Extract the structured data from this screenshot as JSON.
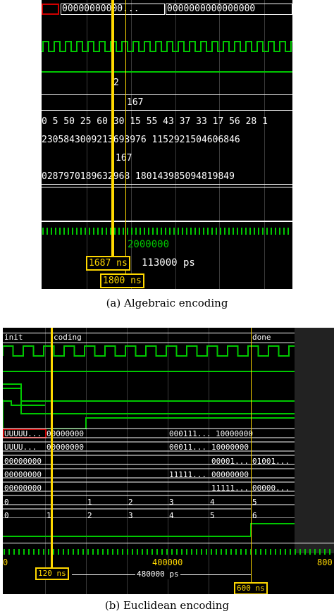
{
  "panel_a": {
    "caption": "(a) Algebraic encoding",
    "top_bus": "00000000000...",
    "top_bus_right": "0000000000000000",
    "val_2": "2",
    "val_167_a": "167",
    "row_numbers": "0 5 50 25 60 30 15 55 43 37 33 17 56 28 1",
    "row_big1": "2305843009213693976 1152921504606846",
    "val_167_b": "167",
    "row_big2": "0287970189632968 180143985094819849",
    "green_value": "2000000",
    "cursor1": "1687 ns",
    "delta": "113000 ps",
    "cursor2": "1800 ns"
  },
  "panel_b": {
    "caption": "(b) Euclidean encoding",
    "state_init": "init",
    "state_coding": "coding",
    "state_done": "done",
    "r1": [
      "UUUUU...",
      "00000000",
      "000111...",
      "10000000"
    ],
    "r2": [
      "UUUU...",
      "00000000",
      "00011...",
      "10000000"
    ],
    "r3": [
      "00000000",
      "00001...",
      "01001..."
    ],
    "r4": [
      "00000000",
      "11111...",
      "00000000"
    ],
    "r5": [
      "00000000",
      "11111...",
      "00000..."
    ],
    "counter1": [
      "0",
      "1",
      "2",
      "3",
      "4",
      "5"
    ],
    "counter2": [
      "0",
      "1",
      "2",
      "3",
      "4",
      "5",
      "6"
    ],
    "axis_labels": [
      "0",
      "400000",
      "800"
    ],
    "cursor1": "120 ns",
    "delta": "480000 ps",
    "cursor2": "600 ns"
  },
  "colors": {
    "green": "#00c800",
    "yellow": "#ffd800",
    "red": "#d00000",
    "white": "#ffffff"
  }
}
